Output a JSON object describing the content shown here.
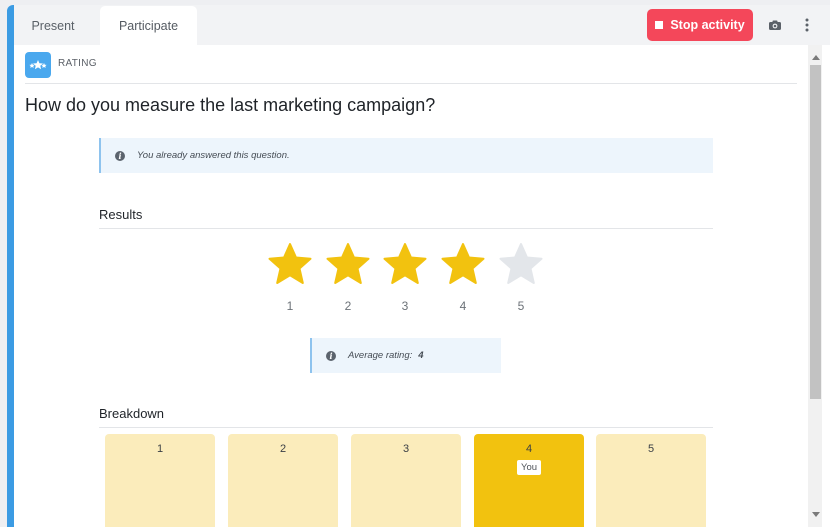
{
  "tabs": [
    {
      "label": "Present",
      "active": false
    },
    {
      "label": "Participate",
      "active": true
    }
  ],
  "toolbar": {
    "stop_label": "Stop activity",
    "stop_color": "#f4475a",
    "camera_icon": "camera-icon",
    "more_icon": "more-vertical-icon"
  },
  "activity": {
    "type_label": "RATING",
    "icon": "rating-stars-icon",
    "question": "How do you measure the last marketing campaign?"
  },
  "notice": {
    "icon": "info-icon",
    "text": "You already answered this question."
  },
  "results": {
    "title": "Results",
    "stars": [
      {
        "label": "1",
        "filled": true
      },
      {
        "label": "2",
        "filled": true
      },
      {
        "label": "3",
        "filled": true
      },
      {
        "label": "4",
        "filled": true
      },
      {
        "label": "5",
        "filled": false
      }
    ],
    "average_label": "Average rating:",
    "average_value": "4"
  },
  "breakdown": {
    "title": "Breakdown",
    "bars": [
      {
        "label": "1",
        "selected": false
      },
      {
        "label": "2",
        "selected": false
      },
      {
        "label": "3",
        "selected": false
      },
      {
        "label": "4",
        "selected": true,
        "tag": "You"
      },
      {
        "label": "5",
        "selected": false
      }
    ]
  },
  "colors": {
    "accent": "#3b9be3",
    "star_filled": "#f2c20f",
    "star_empty": "#e3e6ea",
    "bar": "#fbecbb",
    "bar_selected": "#f2c20f"
  }
}
